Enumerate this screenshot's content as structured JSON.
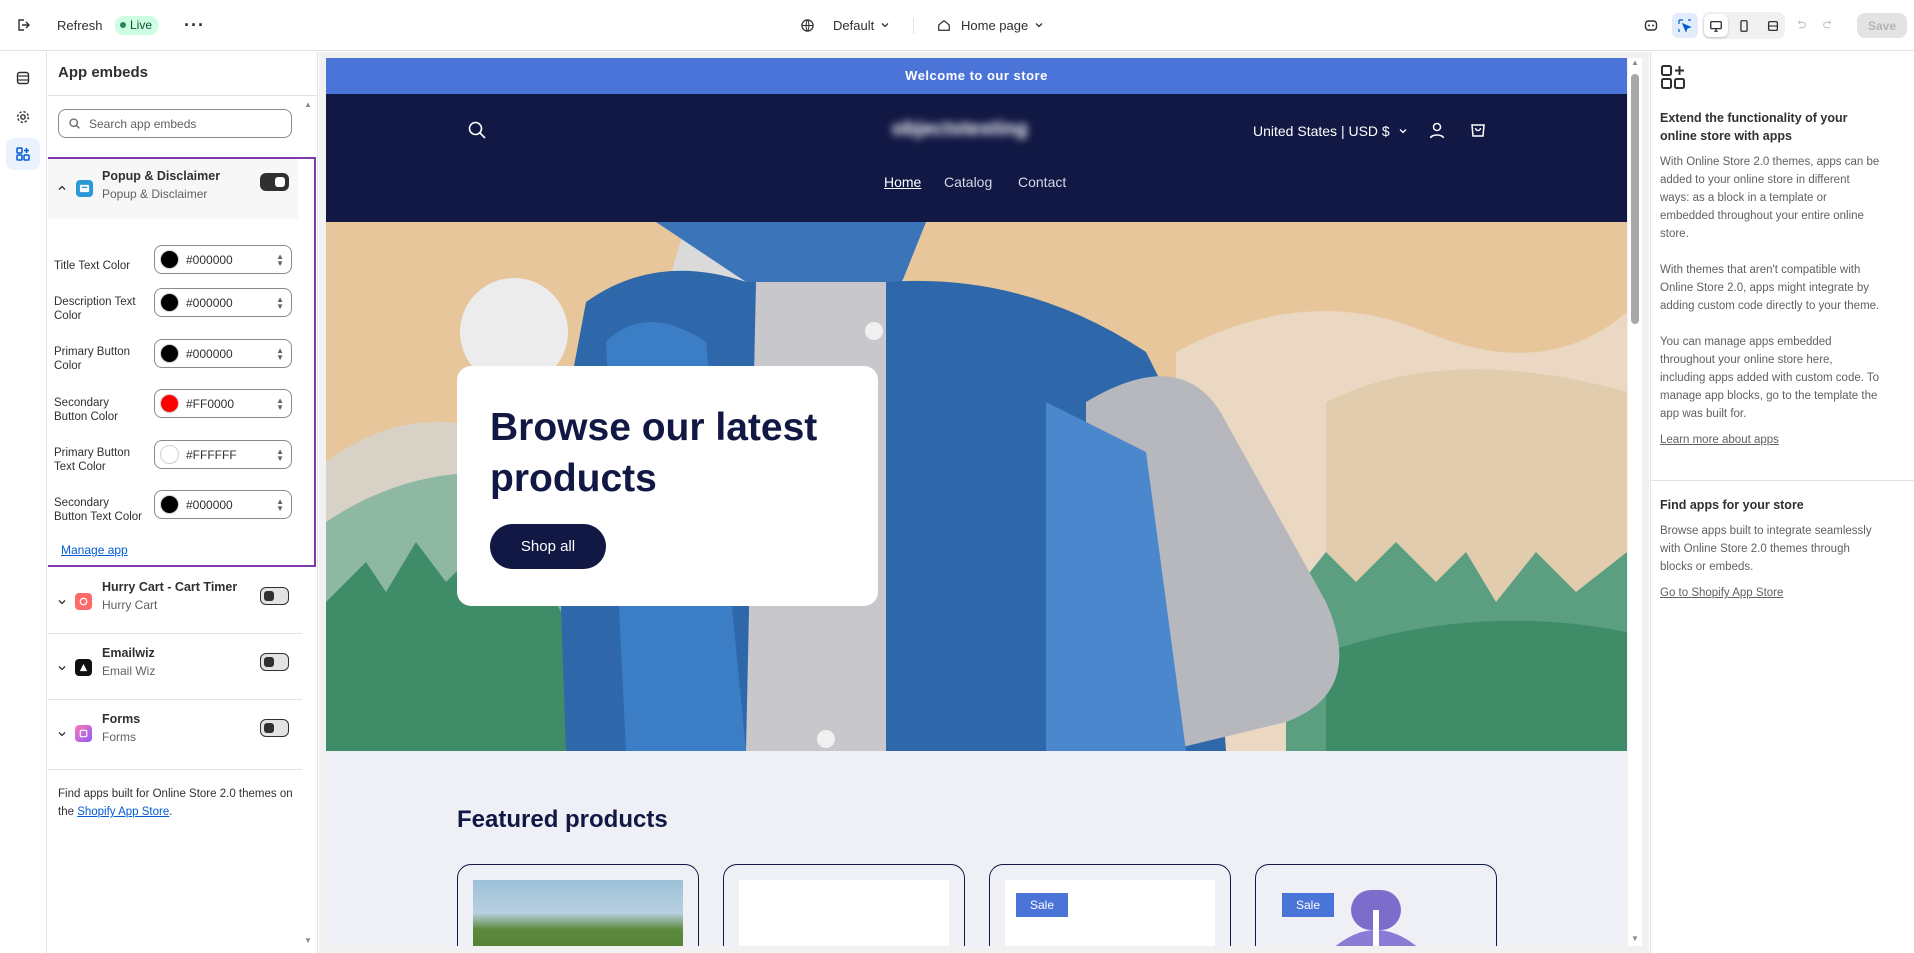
{
  "topbar": {
    "refresh_label": "Refresh",
    "live_label": "Live",
    "theme_label": "Default",
    "page_label": "Home page",
    "save_label": "Save"
  },
  "panel": {
    "title": "App embeds",
    "search_placeholder": "Search app embeds",
    "selected_app": {
      "name": "Popup & Disclaimer",
      "subtitle": "Popup & Disclaimer",
      "enabled": true,
      "fields": [
        {
          "label": "Title Text Color",
          "value": "#000000",
          "color": "#000000"
        },
        {
          "label": "Description Text Color",
          "value": "#000000",
          "color": "#000000"
        },
        {
          "label": "Primary Button Color",
          "value": "#000000",
          "color": "#000000"
        },
        {
          "label": "Secondary Button Color",
          "value": "#FF0000",
          "color": "#FF0000"
        },
        {
          "label": "Primary Button Text Color",
          "value": "#FFFFFF",
          "color": "#FFFFFF"
        },
        {
          "label": "Secondary Button Text Color",
          "value": "#000000",
          "color": "#000000"
        }
      ],
      "manage_label": "Manage app"
    },
    "apps": [
      {
        "name": "Hurry Cart - Cart Timer",
        "subtitle": "Hurry Cart",
        "enabled": false
      },
      {
        "name": "Emailwiz",
        "subtitle": "Email Wiz",
        "enabled": false
      },
      {
        "name": "Forms",
        "subtitle": "Forms",
        "enabled": false
      }
    ],
    "footer_text": "Find apps built for Online Store 2.0 themes on the ",
    "footer_link": "Shopify App Store",
    "footer_end": "."
  },
  "store": {
    "announcement": "Welcome to our store",
    "logo_text": "objectstesting",
    "country": "United States | USD $",
    "nav": [
      "Home",
      "Catalog",
      "Contact"
    ],
    "hero_title": "Browse our latest products",
    "hero_button": "Shop all",
    "featured_title": "Featured products",
    "sale_badge": "Sale"
  },
  "help": {
    "heading1": "Extend the functionality of your online store with apps",
    "p1": "With Online Store 2.0 themes, apps can be added to your online store in different ways: as a block in a template or embedded throughout your entire online store.",
    "p2": "With themes that aren't compatible with Online Store 2.0, apps might integrate by adding custom code directly to your theme.",
    "p3": "You can manage apps embedded throughout your online store here, including apps added with custom code. To manage app blocks, go to the template the app was built for.",
    "link1": "Learn more about apps",
    "heading2": "Find apps for your store",
    "p4": "Browse apps built to integrate seamlessly with Online Store 2.0 themes through blocks or embeds.",
    "link2": "Go to Shopify App Store"
  },
  "colors": {
    "accent_purple": "#7c3aad",
    "store_navy": "#111844",
    "store_blue": "#4b74d9",
    "live_green": "#29845a"
  }
}
